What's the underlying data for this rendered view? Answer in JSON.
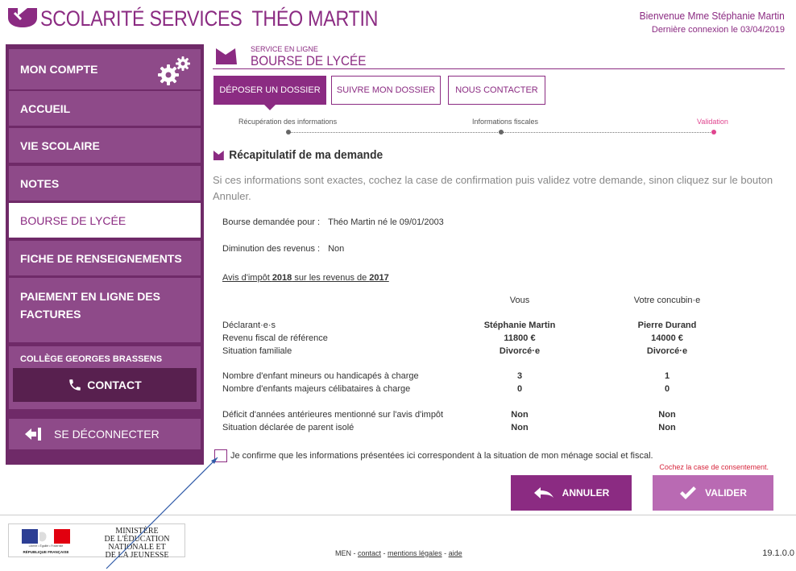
{
  "header": {
    "app_name": "SCOLARITÉ SERVICES",
    "student_name": "THÉO MARTIN",
    "welcome": "Bienvenue Mme Stéphanie Martin",
    "last_login": "Dernière connexion le 03/04/2019"
  },
  "sidebar": {
    "items": [
      {
        "label": "MON COMPTE"
      },
      {
        "label": "ACCUEIL"
      },
      {
        "label": "VIE SCOLAIRE"
      },
      {
        "label": "NOTES"
      },
      {
        "label": "BOURSE DE LYCÉE"
      },
      {
        "label": "FICHE DE RENSEIGNEMENTS"
      },
      {
        "label": "PAIEMENT EN LIGNE DES FACTURES"
      }
    ],
    "active_index": 4,
    "college": "COLLÈGE GEORGES BRASSENS",
    "contact": "CONTACT",
    "logout": "SE DÉCONNECTER"
  },
  "service": {
    "kicker": "SERVICE EN LIGNE",
    "title": "BOURSE DE LYCÉE"
  },
  "tabs": [
    {
      "label": "DÉPOSER UN DOSSIER",
      "active": true
    },
    {
      "label": "SUIVRE MON DOSSIER",
      "active": false
    },
    {
      "label": "NOUS CONTACTER",
      "active": false
    }
  ],
  "steps": [
    {
      "label": "Récupération des informations"
    },
    {
      "label": "Informations fiscales"
    },
    {
      "label": "Validation"
    }
  ],
  "summary": {
    "title": "Récapitulatif de ma demande",
    "intro": "Si ces informations sont exactes, cochez la case de confirmation puis validez votre demande, sinon cliquez sur le bouton Annuler.",
    "bourse_label": "Bourse demandée pour :",
    "bourse_value": "Théo Martin né le 09/01/2003",
    "diminution_label": "Diminution des revenus :",
    "diminution_value": "Non",
    "tax_prefix": "Avis d'impôt ",
    "tax_year": "2018",
    "tax_middle": " sur les revenus de ",
    "tax_income_year": "2017",
    "columns": [
      "Vous",
      "Votre concubin·e"
    ],
    "rows": [
      {
        "label": "Déclarant·e·s",
        "values": [
          "Stéphanie Martin",
          "Pierre Durand"
        ]
      },
      {
        "label": "Revenu fiscal de référence",
        "values": [
          "11800 €",
          "14000 €"
        ]
      },
      {
        "label": "Situation familiale",
        "values": [
          "Divorcé·e",
          "Divorcé·e"
        ]
      },
      {
        "label": "Nombre d'enfant mineurs ou handicapés à charge",
        "values": [
          "3",
          "1"
        ]
      },
      {
        "label": "Nombre d'enfants majeurs célibataires à charge",
        "values": [
          "0",
          "0"
        ]
      },
      {
        "label": "Déficit d'années antérieures mentionné sur l'avis d'impôt",
        "values": [
          "Non",
          "Non"
        ]
      },
      {
        "label": "Situation déclarée de parent isolé",
        "values": [
          "Non",
          "Non"
        ]
      }
    ],
    "confirm_text": "Je confirme que les informations présentées ici correspondent à la situation de mon ménage social et fiscal.",
    "consent_error": "Cochez la case de consentement.",
    "cancel": "ANNULER",
    "validate": "VALIDER"
  },
  "footer": {
    "ministry": "MINISTÈRE DE L'ÉDUCATION NATIONALE ET DE LA JEUNESSE",
    "ministry_lines": [
      "MINISTÈRE",
      "DE L'ÉDUCATION",
      "NATIONALE ET",
      "DE LA JEUNESSE"
    ],
    "rf_motto": "Liberté • Égalité • Fraternité",
    "rf_name": "RÉPUBLIQUE FRANÇAISE",
    "men": "MEN - ",
    "contact": "contact",
    "sep": " - ",
    "legal": "mentions légales",
    "help": "aide",
    "version": "19.1.0.0"
  },
  "colors": {
    "brand": "#8b2b82",
    "sidebar_bg": "#6f2a68",
    "nav_item": "#8e4a89",
    "step_current": "#e0458f",
    "error": "#d7263d"
  }
}
